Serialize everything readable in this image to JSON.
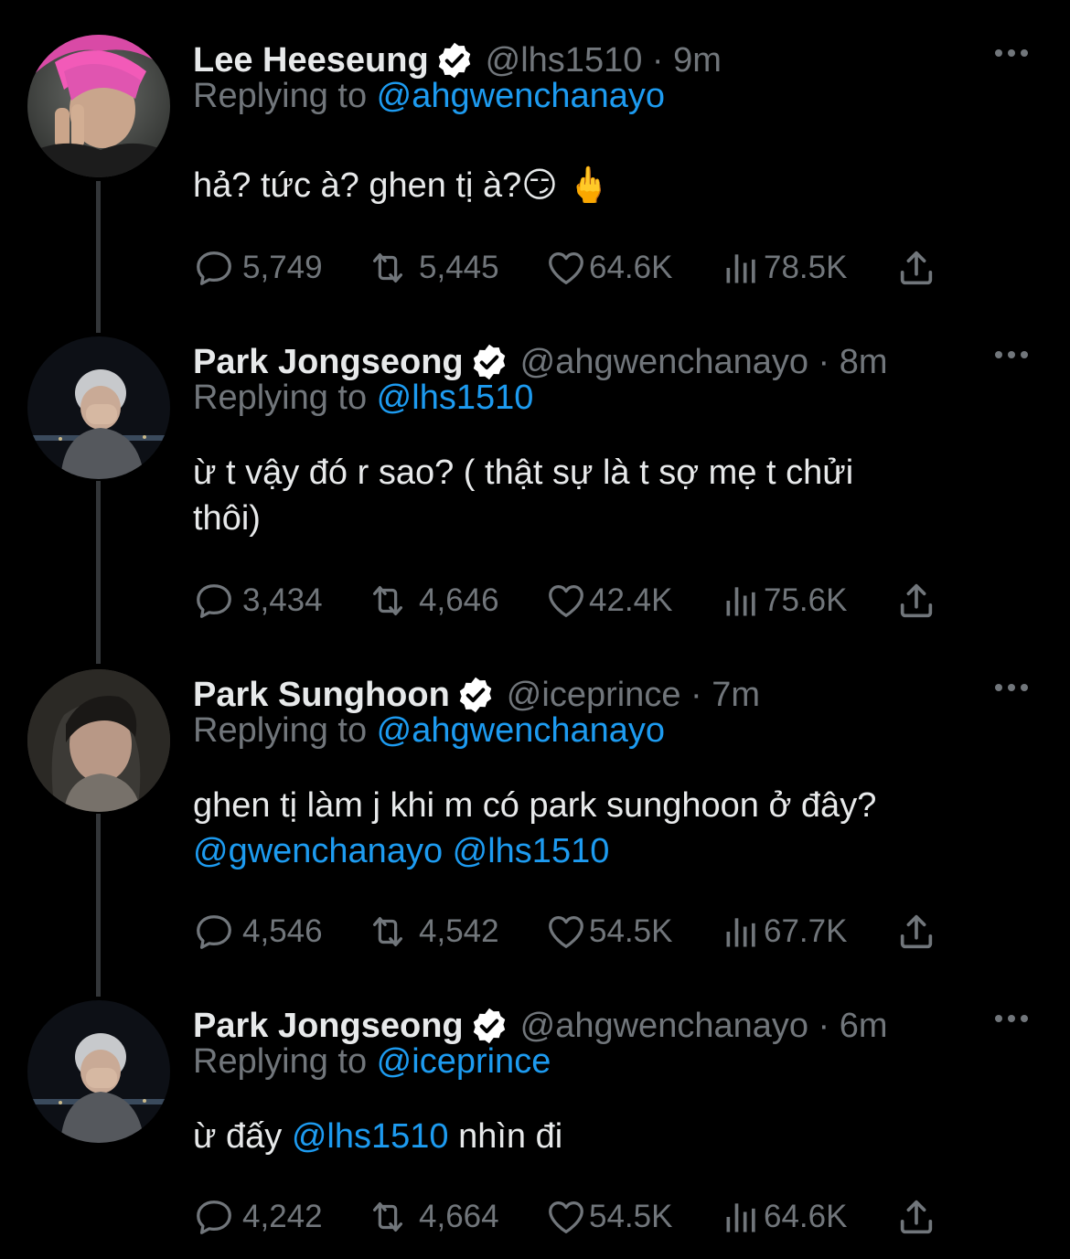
{
  "colors": {
    "background": "#000000",
    "text": "#e7e9ea",
    "secondary": "#71767b",
    "link": "#1d9bf0",
    "verified_badge": "#ffffff",
    "thread_line": "#333639"
  },
  "tweets": [
    {
      "name": "Lee Heeseung",
      "handle": "@lhs1510 · 9m",
      "replying_prefix": "Replying to ",
      "replying_to": "@ahgwenchanayo",
      "text": "hả? tức à? ghen tị à?😏 🖕",
      "replies": "5,749",
      "retweets": "5,445",
      "likes": "64.6K",
      "views": "78.5K",
      "avatar_icon": "avatar-photo"
    },
    {
      "name": "Park Jongseong",
      "handle": "@ahgwenchanayo · 8m",
      "replying_prefix": "Replying to ",
      "replying_to": "@lhs1510",
      "text_line1": "ừ t vậy đó r sao? ( thật sự là t sợ mẹ t chửi",
      "text_line2": "thôi)",
      "replies": "3,434",
      "retweets": "4,646",
      "likes": "42.4K",
      "views": "75.6K",
      "avatar_icon": "avatar-photo"
    },
    {
      "name": "Park Sunghoon",
      "handle": "@iceprince · 7m",
      "replying_prefix": "Replying to ",
      "replying_to": "@ahgwenchanayo",
      "text_line1": "ghen tị làm j khi m có park sunghoon ở đây?",
      "mention1": "@gwenchanayo",
      "mention2": "@lhs1510",
      "replies": "4,546",
      "retweets": "4,542",
      "likes": "54.5K",
      "views": "67.7K",
      "avatar_icon": "avatar-photo"
    },
    {
      "name": "Park Jongseong",
      "handle": "@ahgwenchanayo · 6m",
      "replying_prefix": "Replying to ",
      "replying_to": "@iceprince",
      "text_before": "ừ đấy ",
      "text_mention": "@lhs1510",
      "text_after": " nhìn đi",
      "replies": "4,242",
      "retweets": "4,664",
      "likes": "54.5K",
      "views": "64.6K",
      "avatar_icon": "avatar-photo"
    }
  ],
  "icons": {
    "reply": "reply-icon",
    "retweet": "retweet-icon",
    "like": "heart-icon",
    "views": "views-icon",
    "share": "share-icon",
    "more": "more-icon",
    "verified": "verified-icon"
  }
}
